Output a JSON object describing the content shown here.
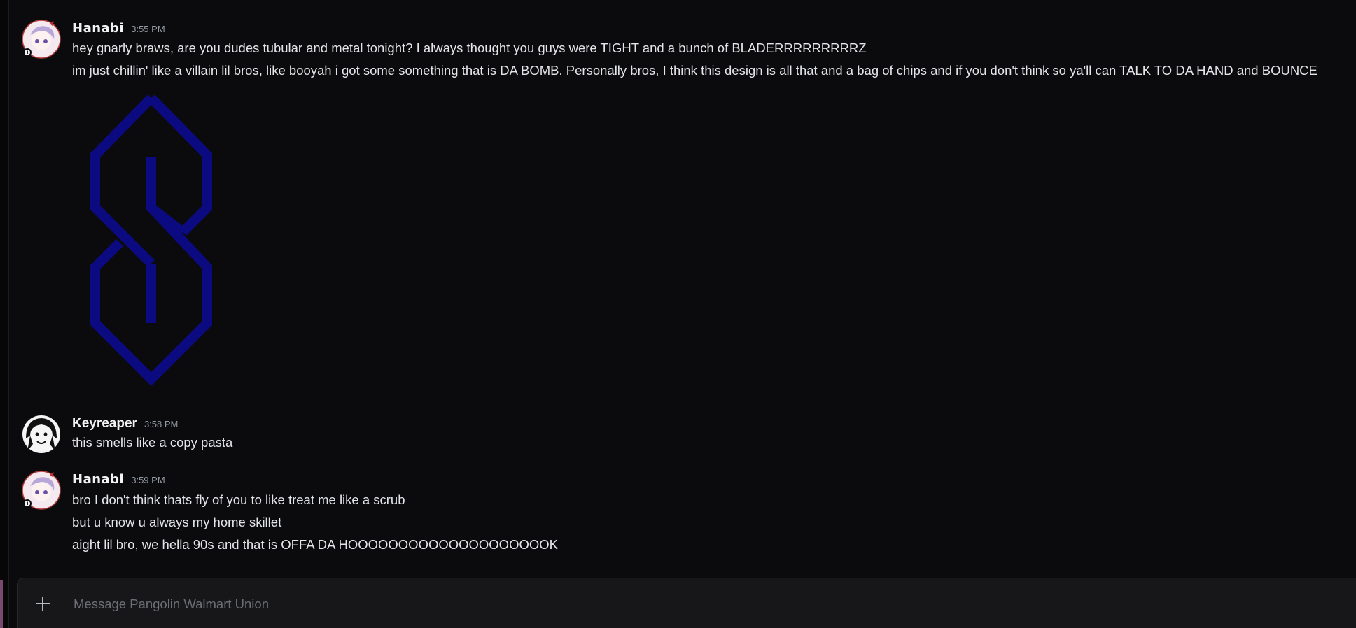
{
  "messages": [
    {
      "author": "Hanabi",
      "time": "3:55 PM",
      "lines": [
        "hey gnarly braws, are you dudes tubular and metal tonight? I always thought you guys were TIGHT and a bunch of BLADERRRRRRRRRZ",
        "im just chillin' like a villain lil bros, like booyah i got some something that is DA BOMB. Personally bros, I think this design is all that and a bag of chips and if you don't think so ya'll can TALK TO DA HAND and BOUNCE"
      ],
      "attachment_color": "#0c0a80"
    },
    {
      "author": "Keyreaper",
      "time": "3:58 PM",
      "lines": [
        "this smells like a copy pasta"
      ]
    },
    {
      "author": "Hanabi",
      "time": "3:59 PM",
      "lines": [
        "bro I don't think thats fly of you to like treat me like a scrub",
        "but u know u always my home skillet",
        "aight lil bro, we hella 90s and that is OFFA DA HOOOOOOOOOOOOOOOOOOOOK"
      ]
    }
  ],
  "composer": {
    "placeholder": "Message Pangolin Walmart Union",
    "add_icon": "plus-icon"
  }
}
